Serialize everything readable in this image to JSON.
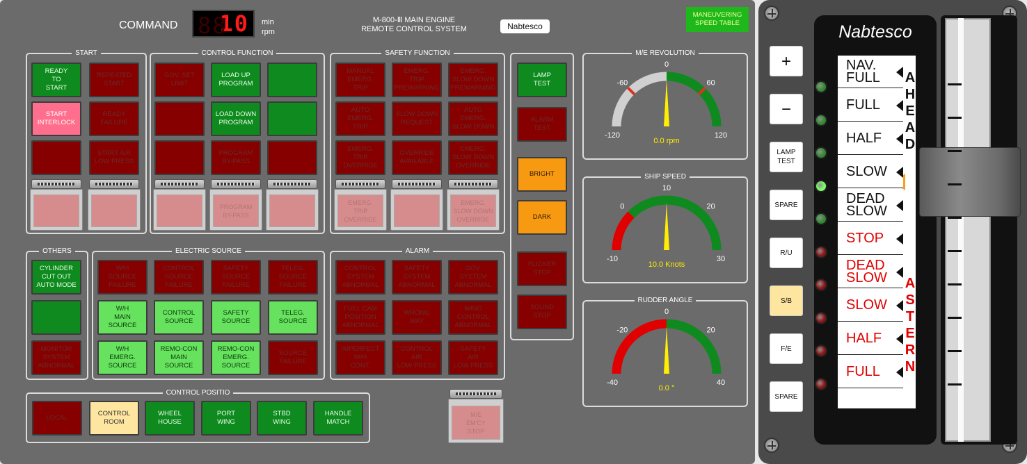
{
  "header": {
    "command_label": "COMMAND",
    "digits": "10",
    "unit1": "min",
    "unit2": "rpm",
    "system_title_1": "M-800-Ⅲ MAIN ENGINE",
    "system_title_2": "REMOTE CONTROL SYSTEM",
    "brand": "Nabtesco",
    "maneuvering": "MANEUVERING\nSPEED TABLE"
  },
  "groups": {
    "start": "START",
    "control_function": "CONTROL FUNCTION",
    "safety_function": "SAFETY FUNCTION",
    "others": "OTHERS",
    "electric_source": "ELECTRIC SOURCE",
    "alarm": "ALARM",
    "control_position": "CONTROL POSITIO"
  },
  "buttons": {
    "ready_to_start": "READY\nTO\nSTART",
    "repeated_start": "REPEATED\nSTART",
    "start_interlock": "START\nINTERLOCK",
    "ready_failure": "READY\nFAILURE",
    "start_air_low": "START AIR\nLOW PRESS",
    "gov_set_limit": "GOV. SET\nLIMIT",
    "load_up": "LOAD UP\nPROGRAM",
    "load_down": "LOAD DOWN\nPROGRAM",
    "program_bypass": "PROGRAM\nBY-PASS",
    "guard_program_bypass": "PROGRAM\nBY-PASS",
    "manual_emerg_trip": "MANUAL\nEMERG.\nTRIP",
    "emerg_trip_prewarning": "EMERG.\nTRIP\nPREWARNING",
    "emerg_slowdown_prewarning": "EMERG.\nSLOW DOWN\nPREWARNING",
    "auto_emerg_trip": "AUTO\nEMERG.\nTRIP",
    "slow_down_request": "SLOW DOWN\nREQUEST",
    "auto_emerg_slowdown": "AUTO\nEMERG.\nSLOW DOWN",
    "emerg_trip_override": "EMERG.\nTRIP\nOVERRIDE",
    "override_available": "OVERRIDE\nAVAILABLE",
    "emerg_slowdown_override": "EMERG.\nSLOW DOWN\nOVERRIDE",
    "guard_emerg_trip_override": "EMERG.\nTRIP\nOVERRIDE",
    "guard_emerg_slowdown_override": "EMERG.\nSLOW DOWN\nOVERRIDE",
    "lamp_test": "LAMP\nTEST",
    "alarm_test": "ALARM\nTEST",
    "bright": "BRIGHT",
    "dark": "DARK",
    "flicker_stop": "FLICKER\nSTOP",
    "sound_stop": "SOUND\nSTOP",
    "cylinder_cutout": "CYLINDER\nCUT OUT\nAUTO MODE",
    "monitor_system": "MONITOR\nSYSTEM\nABNORMAL",
    "wh_source_failure": "W/H\nSOURCE\nFAILURE",
    "control_source_failure": "CONTROL\nSOURCE\nFAILURE",
    "safety_source_failure": "SAFETY\nSOURCE\nFAILURE",
    "teleg_source_failure": "TELEG.\nSOURCE\nFAILURE",
    "wh_main_source": "W/H\nMAIN\nSOURCE",
    "control_source": "CONTROL\nSOURCE",
    "safety_source": "SAFETY\nSOURCE",
    "teleg_source": "TELEG.\nSOURCE",
    "wh_emerg_source": "W/H\nEMERG.\nSOURCE",
    "remocon_main": "REMO-CON\nMAIN\nSOURCE",
    "remocon_emerg": "REMO-CON\nEMERG.\nSOURCE",
    "source_failure": "SOURCE\nFAILURE",
    "control_system_abn": "CONTROL\nSYSTEM\nABNORMAL",
    "safety_system_abn": "SAFETY\nSYSTEM\nABNORMAL",
    "gov_system_abn": "GOV.\nSYSTEM\nABNORMAL",
    "fuel_cam": "FUEL CAM\nPOSITION\nABNORMAL",
    "wrong_way": "WRONG\nWAY",
    "wing_control": "WING\nCONTROL\nABNORMAL",
    "imperfect_wh": "IMPERFECT\nW/H\nCONT.",
    "control_air": "CONTROL\nAIR\nLOW PRESS",
    "safety_air": "SAFETY\nAIR\nLOW PRESS",
    "local": "LOCAL",
    "control_room": "CONTROL\nROOM",
    "wheel_house": "WHEEL\nHOUSE",
    "port_wing": "PORT\nWING",
    "stbd_wing": "STBD\nWING",
    "handle_match": "HANDLE\nMATCH",
    "me_emcy_stop": "M/E\nEM'CY\nSTOP"
  },
  "gauges": {
    "rev": {
      "title": "M/E REVOLUTION",
      "min": -120,
      "max": 120,
      "value": 0,
      "readout": "0.0 rpm",
      "labels": [
        "-120",
        "-60",
        "0",
        "60",
        "120"
      ],
      "ticks": [
        -120,
        -60,
        0,
        60,
        120
      ]
    },
    "speed": {
      "title": "SHIP SPEED",
      "min": -10,
      "max": 30,
      "value": 10,
      "readout": "10.0 Knots",
      "labels": [
        "-10",
        "0",
        "10",
        "20",
        "30"
      ],
      "ticks": [
        -10,
        0,
        10,
        20,
        30
      ]
    },
    "rudder": {
      "title": "RUDDER ANGLE",
      "min": -40,
      "max": 40,
      "value": 0,
      "readout": "0.0 °",
      "labels": [
        "-40",
        "-20",
        "0",
        "20",
        "40"
      ],
      "ticks": [
        -40,
        -20,
        0,
        20,
        40
      ]
    }
  },
  "telegraph": {
    "brand": "Nabtesco",
    "ahead": "AHEAD",
    "astern": "ASTERN",
    "side_buttons": [
      "+",
      "−",
      "LAMP\nTEST",
      "SPARE",
      "R/U",
      "S/B",
      "F/E",
      "SPARE"
    ],
    "orders": [
      "NAV.\nFULL",
      "FULL",
      "HALF",
      "SLOW",
      "DEAD\nSLOW",
      "STOP",
      "DEAD\nSLOW",
      "SLOW",
      "HALF",
      "FULL"
    ],
    "selected_order_index": 3,
    "colors": {
      "ahead": "#111111",
      "astern": "#e00000",
      "led_green": "#2f8a2f",
      "led_red": "#8a1414",
      "led_active": "#7dff6a",
      "pointer": "#f5a020"
    }
  }
}
